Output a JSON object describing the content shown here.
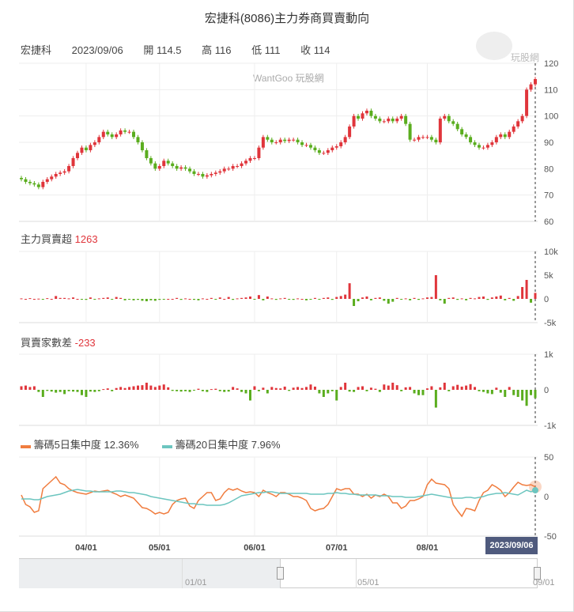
{
  "title": "宏捷科(8086)主力券商買賣動向",
  "info": {
    "name": "宏捷科",
    "date": "2023/09/06",
    "open": "開 114.5",
    "high": "高 116",
    "low": "低 111",
    "close": "收 114"
  },
  "watermark": "WantGoo 玩股網",
  "logo_text": "玩股網",
  "tooltip_date": "2023/09/06",
  "colors": {
    "up": "#e0353b",
    "down": "#5aad1e",
    "conc5": "#f07c3e",
    "conc20": "#6cc5bf",
    "grid": "#eeeeee"
  },
  "navigator": {
    "labels": [
      "01/01",
      "05/01",
      "09/01"
    ]
  },
  "chart_data": [
    {
      "type": "candlestick",
      "name": "price",
      "yticks": [
        120,
        110,
        100,
        90,
        80,
        70,
        60
      ],
      "ylim": [
        60,
        120
      ],
      "x_ticks": [
        {
          "label": "04/01",
          "index": 15
        },
        {
          "label": "05/01",
          "index": 32
        },
        {
          "label": "06/01",
          "index": 54
        },
        {
          "label": "07/01",
          "index": 73
        },
        {
          "label": "08/01",
          "index": 94
        }
      ],
      "close": [
        76,
        75,
        74.5,
        74,
        73,
        75,
        76,
        77,
        78,
        78.5,
        79,
        81,
        84,
        86,
        88,
        87,
        89,
        90,
        92,
        94,
        93,
        92,
        93,
        94.5,
        94,
        94,
        92,
        90,
        87,
        84,
        82,
        80,
        81,
        83,
        82,
        81,
        80,
        80.5,
        80,
        79,
        78,
        78,
        77,
        77.5,
        78,
        78.5,
        79,
        80,
        80,
        81,
        81,
        82,
        83,
        84,
        84,
        88,
        92,
        91,
        90,
        90,
        91,
        90.5,
        91,
        91,
        90,
        89,
        89,
        88,
        87,
        86,
        86,
        87,
        88,
        88.5,
        90,
        92,
        96,
        100,
        99,
        101,
        102,
        100,
        99,
        98,
        98,
        99,
        98,
        99,
        100,
        97,
        91,
        91,
        92,
        92,
        92,
        91,
        90,
        99,
        100,
        98,
        97,
        95,
        93,
        92,
        90,
        89,
        88,
        88,
        89,
        90,
        92,
        93,
        92,
        94,
        96,
        98,
        100,
        110,
        112,
        114
      ]
    },
    {
      "type": "bar",
      "name": "main_force",
      "label": "主力買賣超",
      "last": "1263",
      "yticks": [
        "10k",
        "5k",
        "0",
        "-5k"
      ],
      "ylim": [
        -5000,
        10000
      ],
      "values": [
        100,
        0,
        150,
        0,
        50,
        -50,
        150,
        0,
        600,
        200,
        200,
        100,
        300,
        0,
        -100,
        -200,
        300,
        -100,
        100,
        200,
        300,
        -100,
        400,
        200,
        -300,
        -100,
        -300,
        -200,
        -400,
        -500,
        -300,
        -400,
        -200,
        -100,
        0,
        0,
        200,
        -200,
        100,
        0,
        -200,
        -300,
        100,
        0,
        200,
        -100,
        300,
        0,
        400,
        -200,
        100,
        200,
        300,
        500,
        -100,
        800,
        -300,
        500,
        100,
        -200,
        100,
        200,
        -100,
        -200,
        100,
        0,
        -300,
        -100,
        200,
        -100,
        200,
        300,
        -200,
        400,
        600,
        900,
        3300,
        -1500,
        -500,
        300,
        500,
        -300,
        200,
        300,
        -400,
        -1000,
        -600,
        200,
        -100,
        100,
        -300,
        200,
        -200,
        100,
        300,
        400,
        5000,
        -300,
        -1000,
        200,
        300,
        -200,
        100,
        -300,
        200,
        100,
        400,
        500,
        -200,
        300,
        500,
        700,
        -300,
        200,
        -400,
        600,
        2500,
        4000,
        -800,
        1263
      ]
    },
    {
      "type": "bar",
      "name": "broker_diff",
      "label": "買賣家數差",
      "last": "-233",
      "yticks": [
        "1k",
        "0",
        "-1k"
      ],
      "ylim": [
        -1000,
        1000
      ],
      "values": [
        100,
        120,
        80,
        100,
        -60,
        -200,
        -30,
        -50,
        -80,
        -60,
        -120,
        -40,
        -50,
        -60,
        -150,
        -200,
        -50,
        -60,
        -40,
        20,
        40,
        -40,
        50,
        80,
        50,
        80,
        100,
        120,
        130,
        200,
        120,
        80,
        120,
        150,
        70,
        -30,
        -40,
        -50,
        -40,
        -60,
        -20,
        30,
        -40,
        -60,
        20,
        30,
        -40,
        -60,
        -50,
        80,
        40,
        -60,
        -100,
        -300,
        100,
        -40,
        60,
        -100,
        80,
        50,
        40,
        90,
        -30,
        60,
        80,
        50,
        80,
        150,
        90,
        -100,
        -200,
        -100,
        -40,
        -300,
        80,
        200,
        -50,
        -60,
        80,
        100,
        -40,
        60,
        30,
        -60,
        150,
        120,
        200,
        130,
        -40,
        70,
        80,
        -100,
        -150,
        -150,
        40,
        100,
        -500,
        70,
        200,
        -40,
        100,
        140,
        90,
        120,
        160,
        80,
        -40,
        -60,
        -100,
        -120,
        60,
        -80,
        -200,
        80,
        -150,
        -200,
        -300,
        -450,
        -150,
        -233
      ]
    },
    {
      "type": "line",
      "name": "concentration",
      "yticks": [
        "50",
        "0",
        "-50"
      ],
      "ylim": [
        -50,
        50
      ],
      "series": [
        {
          "name": "籌碼5日集中度",
          "last": "12.36%",
          "values": [
            2,
            -10,
            -13,
            -20,
            -18,
            10,
            15,
            20,
            25,
            17,
            15,
            10,
            7,
            5,
            4,
            3,
            5,
            7,
            6,
            7,
            8,
            5,
            3,
            0,
            2,
            0,
            -2,
            -8,
            -14,
            -15,
            -18,
            -22,
            -20,
            -22,
            -20,
            -10,
            -5,
            -3,
            -2,
            -12,
            -15,
            -5,
            0,
            5,
            5,
            -5,
            -3,
            5,
            10,
            8,
            10,
            7,
            5,
            6,
            5,
            0,
            8,
            5,
            3,
            0,
            5,
            5,
            3,
            0,
            0,
            -2,
            -5,
            -15,
            -18,
            -16,
            -15,
            -10,
            0,
            10,
            8,
            10,
            10,
            3,
            3,
            0,
            3,
            -2,
            2,
            0,
            3,
            0,
            -8,
            -8,
            -15,
            -12,
            -5,
            -5,
            -3,
            0,
            15,
            22,
            17,
            16,
            15,
            10,
            -10,
            -18,
            -25,
            -15,
            -16,
            -18,
            -5,
            5,
            8,
            15,
            12,
            8,
            0,
            5,
            12,
            18,
            15,
            14,
            15,
            12.36
          ]
        },
        {
          "name": "籌碼20日集中度",
          "last": "7.96%",
          "values": [
            -3,
            -3,
            -3,
            -4,
            -4,
            -2,
            0,
            1,
            2,
            3,
            5,
            7,
            8,
            9,
            8,
            7,
            7,
            6,
            6,
            6,
            6,
            6,
            7,
            7,
            6,
            5,
            5,
            4,
            3,
            2,
            0,
            -1,
            -2,
            -3,
            -4,
            -5,
            -6,
            -7,
            -8,
            -9,
            -9,
            -10,
            -10,
            -11,
            -11,
            -11,
            -11,
            -10,
            -8,
            -5,
            -2,
            1,
            2,
            3,
            4,
            5,
            5,
            6,
            6,
            5,
            4,
            4,
            4,
            4,
            4,
            4,
            4,
            3,
            3,
            3,
            3,
            4,
            4,
            5,
            4,
            4,
            3,
            3,
            2,
            2,
            2,
            2,
            2,
            1,
            1,
            1,
            0,
            0,
            0,
            -1,
            -1,
            -1,
            0,
            1,
            2,
            3,
            2,
            1,
            0,
            -1,
            -2,
            -2,
            -2,
            -1,
            -1,
            -2,
            -1,
            0,
            2,
            3,
            4,
            4,
            5,
            4,
            3,
            2,
            5,
            8,
            6,
            7.96
          ]
        }
      ]
    }
  ]
}
